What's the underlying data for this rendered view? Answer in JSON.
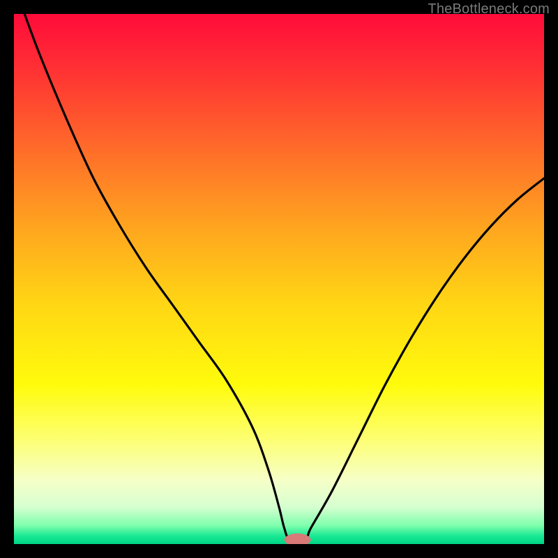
{
  "watermark": "TheBottleneck.com",
  "chart_data": {
    "type": "line",
    "title": "",
    "xlabel": "",
    "ylabel": "",
    "xlim": [
      0,
      100
    ],
    "ylim": [
      0,
      100
    ],
    "grid": false,
    "legend": false,
    "series": [
      {
        "name": "bottleneck-curve",
        "x": [
          2,
          5,
          10,
          15,
          20,
          25,
          30,
          35,
          40,
          45,
          48,
          50,
          51,
          52,
          55,
          56,
          60,
          65,
          70,
          75,
          80,
          85,
          90,
          95,
          100
        ],
        "y": [
          100,
          92,
          80,
          69,
          60,
          52,
          45,
          38,
          31,
          22,
          14,
          7,
          3,
          1,
          1,
          3,
          10,
          20,
          30,
          39,
          47,
          54,
          60,
          65,
          69
        ]
      }
    ],
    "optimal_marker": {
      "x": 53.5,
      "y": 0.8,
      "rx": 2.5,
      "ry": 1.2
    },
    "background_gradient": {
      "stops": [
        {
          "offset": 0.0,
          "color": "#ff0b3a"
        },
        {
          "offset": 0.1,
          "color": "#ff2f34"
        },
        {
          "offset": 0.25,
          "color": "#ff6a2a"
        },
        {
          "offset": 0.4,
          "color": "#ffa41f"
        },
        {
          "offset": 0.55,
          "color": "#ffd714"
        },
        {
          "offset": 0.7,
          "color": "#fffb0c"
        },
        {
          "offset": 0.8,
          "color": "#fdff70"
        },
        {
          "offset": 0.88,
          "color": "#f6ffc8"
        },
        {
          "offset": 0.93,
          "color": "#d6ffd0"
        },
        {
          "offset": 0.965,
          "color": "#7effad"
        },
        {
          "offset": 0.985,
          "color": "#18e893"
        },
        {
          "offset": 1.0,
          "color": "#00d686"
        }
      ]
    }
  }
}
